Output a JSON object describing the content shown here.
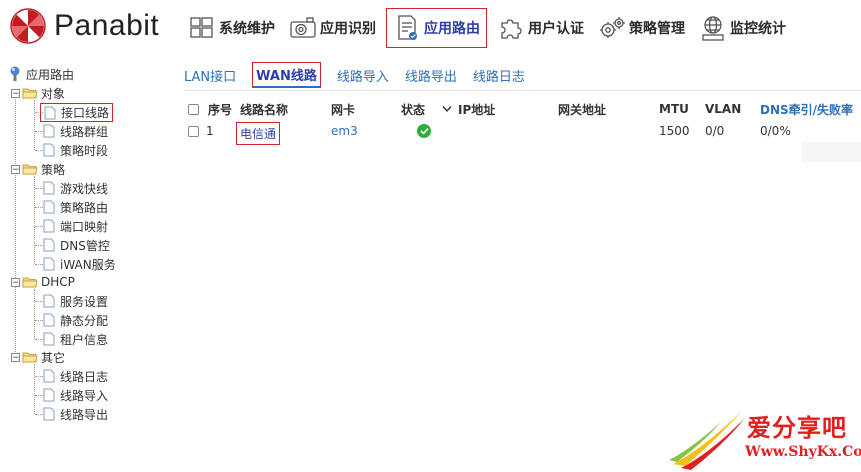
{
  "header": {
    "brand": "Panabit",
    "nav": [
      {
        "label": "系统维护",
        "icon": "windows-grid-icon",
        "active": false
      },
      {
        "label": "应用识别",
        "icon": "camera-icon",
        "active": false
      },
      {
        "label": "应用路由",
        "icon": "document-route-icon",
        "active": true
      },
      {
        "label": "用户认证",
        "icon": "puzzle-icon",
        "active": false
      },
      {
        "label": "策略管理",
        "icon": "gears-icon",
        "active": false
      },
      {
        "label": "监控统计",
        "icon": "globe-monitor-icon",
        "active": false
      }
    ]
  },
  "tree": {
    "root": "应用路由",
    "groups": [
      {
        "label": "对象",
        "items": [
          "接口线路",
          "线路群组",
          "策略时段"
        ]
      },
      {
        "label": "策略",
        "items": [
          "游戏快线",
          "策略路由",
          "端口映射",
          "DNS管控",
          "iWAN服务"
        ]
      },
      {
        "label": "DHCP",
        "items": [
          "服务设置",
          "静态分配",
          "租户信息"
        ]
      },
      {
        "label": "其它",
        "items": [
          "线路日志",
          "线路导入",
          "线路导出"
        ]
      }
    ],
    "selected": "接口线路"
  },
  "tabs": [
    {
      "label": "LAN接口",
      "active": false
    },
    {
      "label": "WAN线路",
      "active": true
    },
    {
      "label": "线路导入",
      "active": false
    },
    {
      "label": "线路导出",
      "active": false
    },
    {
      "label": "线路日志",
      "active": false
    }
  ],
  "table": {
    "columns": [
      "序号",
      "线路名称",
      "网卡",
      "状态",
      "IP地址",
      "网关地址",
      "MTU",
      "VLAN",
      "DNS牵引/失败率"
    ],
    "rows": [
      {
        "index": "1",
        "name": "电信通",
        "nic": "em3",
        "status": "ok",
        "ip": "",
        "gateway": "",
        "mtu": "1500",
        "vlan": "0/0",
        "dns": "0/0%"
      }
    ]
  },
  "watermark": {
    "title": "爱分享吧",
    "url": "Www.ShyKx.Com"
  },
  "colors": {
    "highlight_box": "#d0262b",
    "link_blue": "#2f6fb8",
    "active_blue": "#2f3fa8",
    "status_green": "#2fae3a",
    "watermark_red": "#e0201f"
  }
}
